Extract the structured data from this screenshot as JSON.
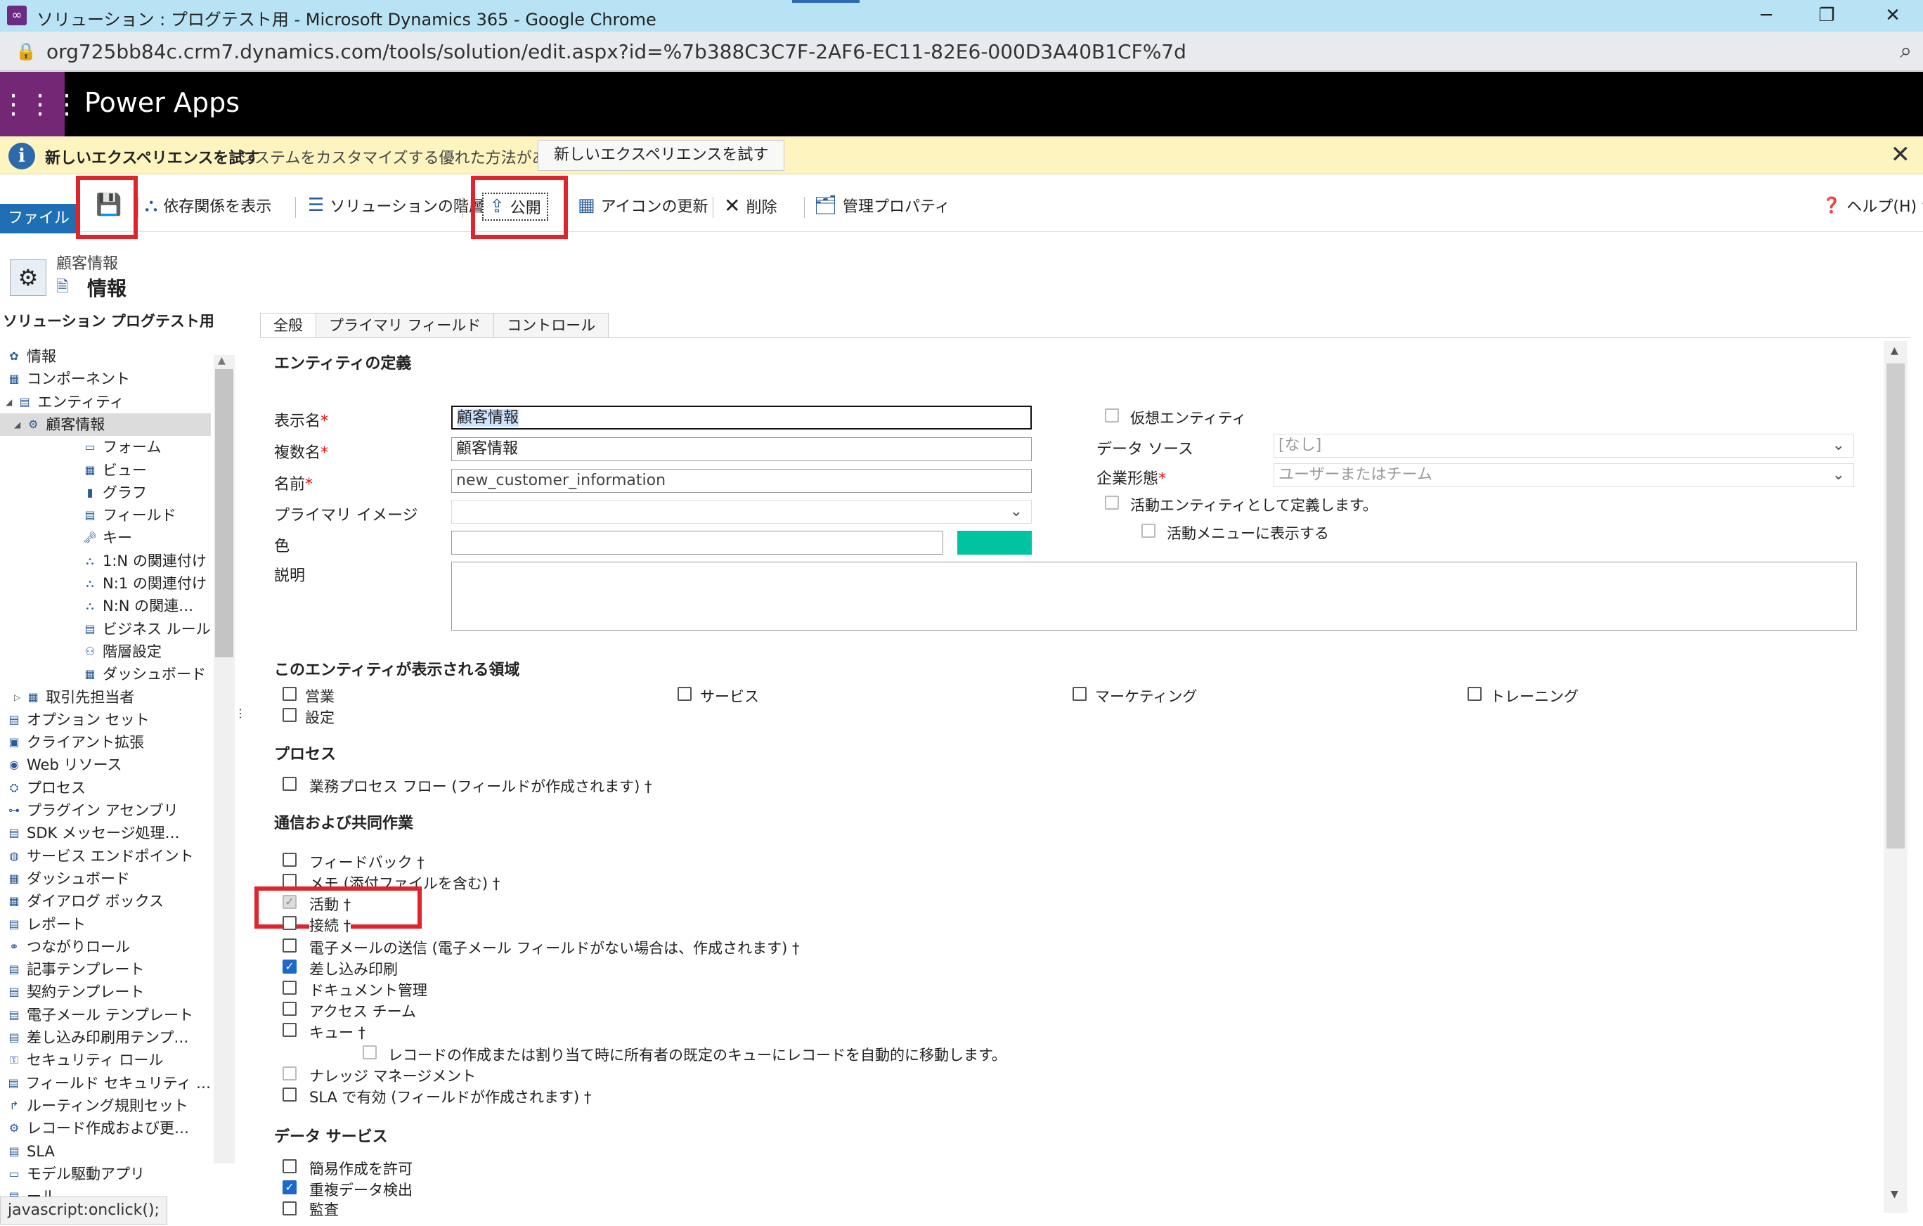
{
  "window": {
    "title": "ソリューション : プログテスト用 - Microsoft Dynamics 365 - Google Chrome",
    "minimize": "─",
    "restore": "❐",
    "close": "✕"
  },
  "addressbar": {
    "url": "org725bb84c.crm7.dynamics.com/tools/solution/edit.aspx?id=%7b388C3C7F-2AF6-EC11-82E6-000D3A40B1CF%7d"
  },
  "app": {
    "brand": "Power Apps"
  },
  "notification": {
    "heading": "新しいエクスペリエンスを試す",
    "message": "システムをカスタマイズする優れた方法があります",
    "button": "新しいエクスペリエンスを試す"
  },
  "toolbar": {
    "file": "ファイル",
    "show_dependencies": "依存関係を表示",
    "solution_layers": "ソリューションの階層",
    "publish": "公開",
    "update_icons": "アイコンの更新",
    "delete": "削除",
    "managed_properties": "管理プロパティ",
    "help": "ヘルプ(H)"
  },
  "header": {
    "entity": "顧客情報",
    "page": "情報",
    "solution": "ソリューション プログテスト用"
  },
  "tree": [
    {
      "label": "情報",
      "indent": 0
    },
    {
      "label": "コンポーネント",
      "indent": 0
    },
    {
      "label": "エンティティ",
      "indent": 1
    },
    {
      "label": "顧客情報",
      "indent": 2
    },
    {
      "label": "フォーム",
      "indent": 3
    },
    {
      "label": "ビュー",
      "indent": 3
    },
    {
      "label": "グラフ",
      "indent": 3
    },
    {
      "label": "フィールド",
      "indent": 3
    },
    {
      "label": "キー",
      "indent": 3
    },
    {
      "label": "1:N の関連付け",
      "indent": 3
    },
    {
      "label": "N:1 の関連付け",
      "indent": 3
    },
    {
      "label": "N:N の関連…",
      "indent": 3
    },
    {
      "label": "ビジネス ルール",
      "indent": 3
    },
    {
      "label": "階層設定",
      "indent": 3
    },
    {
      "label": "ダッシュボード",
      "indent": 3
    },
    {
      "label": "取引先担当者",
      "indent": 2
    },
    {
      "label": "オプション セット",
      "indent": 1
    },
    {
      "label": "クライアント拡張",
      "indent": 1
    },
    {
      "label": "Web リソース",
      "indent": 1
    },
    {
      "label": "プロセス",
      "indent": 1
    },
    {
      "label": "プラグイン アセンブリ",
      "indent": 1
    },
    {
      "label": "SDK メッセージ処理…",
      "indent": 1
    },
    {
      "label": "サービス エンドポイント",
      "indent": 1
    },
    {
      "label": "ダッシュボード",
      "indent": 1
    },
    {
      "label": "ダイアログ ボックス",
      "indent": 1
    },
    {
      "label": "レポート",
      "indent": 1
    },
    {
      "label": "つながりロール",
      "indent": 1
    },
    {
      "label": "記事テンプレート",
      "indent": 1
    },
    {
      "label": "契約テンプレート",
      "indent": 1
    },
    {
      "label": "電子メール テンプレート",
      "indent": 1
    },
    {
      "label": "差し込み印刷用テンプ…",
      "indent": 1
    },
    {
      "label": "セキュリティ ロール",
      "indent": 1
    },
    {
      "label": "フィールド セキュリティ …",
      "indent": 1
    },
    {
      "label": "ルーティング規則セット",
      "indent": 1
    },
    {
      "label": "レコード作成および更…",
      "indent": 1
    },
    {
      "label": "SLA",
      "indent": 1
    },
    {
      "label": "モデル駆動アプリ",
      "indent": 1
    },
    {
      "label": "ール",
      "indent": 1
    }
  ],
  "status_tip": "javascript:onclick();",
  "tabs": [
    "全般",
    "プライマリ フィールド",
    "コントロール"
  ],
  "form": {
    "section_definition": "エンティティの定義",
    "display_name_label": "表示名",
    "display_name": "顧客情報",
    "plural_name_label": "複数名",
    "plural_name": "顧客情報",
    "name_label": "名前",
    "name": "new_customer_information",
    "primary_image_label": "プライマリ イメージ",
    "color_label": "色",
    "color_swatch": "#00c4a0",
    "description_label": "説明",
    "virtual_entity": "仮想エンティティ",
    "data_source_label": "データ ソース",
    "data_source": "[なし]",
    "ownership_label": "企業形態",
    "ownership": "ユーザーまたはチーム",
    "define_activity": "活動エンティティとして定義します。",
    "show_activity_menu": "活動メニューに表示する",
    "section_areas": "このエンティティが表示される領域",
    "areas": [
      "営業",
      "サービス",
      "マーケティング",
      "トレーニング",
      "設定"
    ],
    "section_process": "プロセス",
    "bpf": "業務プロセス フロー (フィールドが作成されます) †",
    "section_comm": "通信および共同作業",
    "feedback": "フィードバック †",
    "notes": "メモ (添付ファイルを含む) †",
    "activities": "活動 †",
    "connections": "接続 †",
    "email": "電子メールの送信 (電子メール フィールドがない場合は、作成されます) †",
    "mail_merge": "差し込み印刷",
    "doc_mgmt": "ドキュメント管理",
    "access_teams": "アクセス チーム",
    "queues": "キュー †",
    "queue_auto": "レコードの作成または割り当て時に所有者の既定のキューにレコードを自動的に移動します。",
    "knowledge": "ナレッジ マネージメント",
    "sla": "SLA で有効 (フィールドが作成されます) †",
    "section_data": "データ サービス",
    "quick_create": "簡易作成を許可",
    "dup_detect": "重複データ検出",
    "audit": "監査"
  }
}
